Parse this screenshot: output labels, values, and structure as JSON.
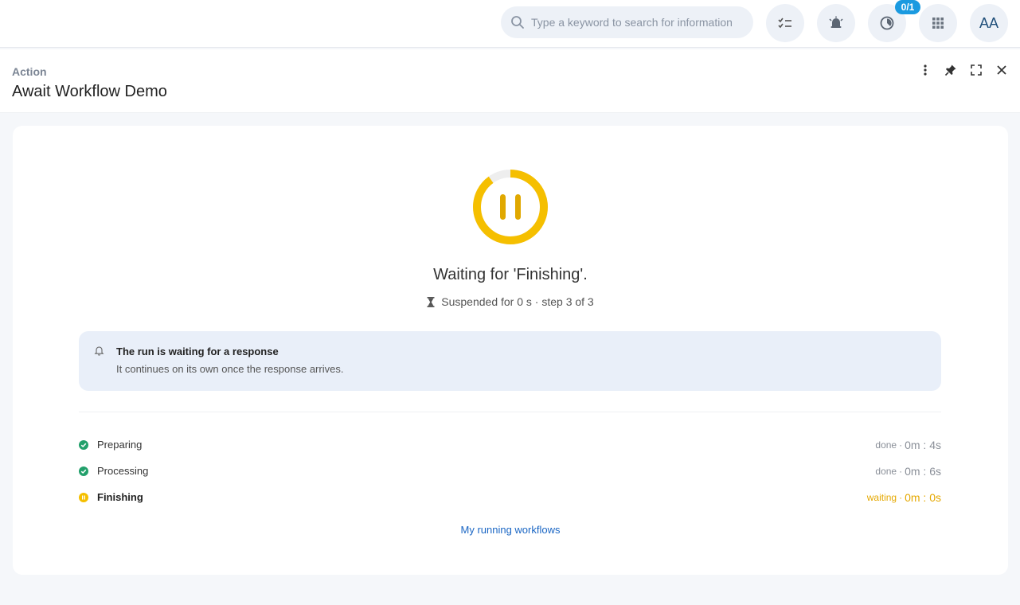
{
  "topbar": {
    "search_placeholder": "Type a keyword to search for information",
    "badge": "0/1",
    "avatar_initials": "AA"
  },
  "panel": {
    "kicker": "Action",
    "title": "Await Workflow Demo"
  },
  "status": {
    "title": "Waiting for 'Finishing'.",
    "subtitle": "Suspended for 0 s · step 3 of 3",
    "progress_fraction": 0.9,
    "accent_color": "#f5bf00"
  },
  "notice": {
    "title": "The run is waiting for a response",
    "text": "It continues on its own once the response arrives."
  },
  "steps": [
    {
      "label": "Preparing",
      "state": "done",
      "time": "0m : 4s"
    },
    {
      "label": "Processing",
      "state": "done",
      "time": "0m : 6s"
    },
    {
      "label": "Finishing",
      "state": "waiting",
      "time": "0m : 0s"
    }
  ],
  "link": "My running workflows",
  "colors": {
    "done": "#22a06b",
    "waiting": "#f5bf00",
    "link": "#1a66c4"
  }
}
